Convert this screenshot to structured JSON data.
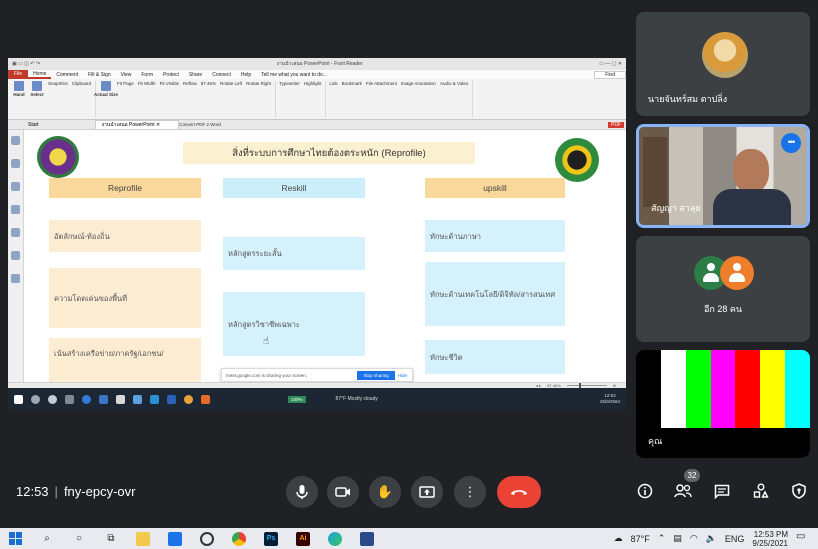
{
  "app": {
    "window_title": "งานนำเสนอ PowerPoint - Foxit Reader",
    "menu_tabs": [
      "File",
      "Home",
      "Comment",
      "Fill & Sign",
      "View",
      "Form",
      "Protect",
      "Share",
      "Connect",
      "Help"
    ],
    "tell_me": "Tell me what you want to do...",
    "find_label": "Find",
    "tools": [
      "SnapShot",
      "Clipboard",
      "Fit Page",
      "Fit Width",
      "Fit Visible",
      "Reflow",
      "97.46%",
      "Rotate Left",
      "Rotate Right",
      "Typewriter",
      "Highlight",
      "Link",
      "Bookmark",
      "File Attachment",
      "Image Annotation",
      "Audio & Video"
    ],
    "tool_big": [
      "Hand",
      "Select",
      "Actual Size"
    ],
    "doc_tabs": [
      "Start",
      "งานนำเสนอ PowerPoint"
    ],
    "convert_label": "Convert PDF 2 Word",
    "zoom_status": "97.46%"
  },
  "slide": {
    "title": "สิ่งที่ระบบการศึกษาไทยต้องตระหนัก (Reprofile)",
    "headers": {
      "reprofile": "Reprofile",
      "reskill": "Reskill",
      "upskill": "upskill"
    },
    "reprofile_items": [
      "อัตลักษณ์-ท้องถิ่น",
      "ความโดดเด่นของพื้นที่",
      "เน้นสร้างเครือข่าย/ภาครัฐ/เอกชน/"
    ],
    "reskill_items": [
      "หลักสูตรระยะสั้น",
      "หลักสูตรวิชาชีพเฉพาะ"
    ],
    "upskill_items": [
      "ทักษะด้านภาษา",
      "ทักษะด้านเทคโนโลยี/ดิจิทัล/สารสนเทศ",
      "ทักษะชีวิต"
    ]
  },
  "share_bar": {
    "message": "meet.google.com is sharing your screen.",
    "stop_label": "Stop sharing",
    "hide_label": "Hide"
  },
  "inner_taskbar": {
    "battery": "100%",
    "weather": "87°F Mostly cloudy",
    "time": "12:53",
    "date": "25/9/2564"
  },
  "participants": [
    {
      "name": "นายจันทร์สม ตาปลิ่ง"
    },
    {
      "name": "สัญญา สาลุย"
    },
    {
      "name": "อีก 28 คน"
    },
    {
      "name": "คุณ"
    }
  ],
  "colors": {
    "meet_bg": "#202124",
    "tile_bg": "#3c4043",
    "active_border": "#8ab4f8",
    "end_call": "#ea4335",
    "reprofile_fill": "#fad79b",
    "reskill_fill": "#cdeefb",
    "title_fill": "#fbf0cf",
    "test_bars": [
      "#000000",
      "#ffffff",
      "#00ff00",
      "#ff00ff",
      "#ff0000",
      "#ffff00",
      "#00ffff"
    ]
  },
  "meeting": {
    "time": "12:53",
    "separator": "|",
    "code": "fny-epcy-ovr",
    "people_count": "32"
  },
  "controls": {
    "mic": "mic-icon",
    "camera": "camera-icon",
    "hand": "raise-hand-icon",
    "present": "present-icon",
    "more": "more-vert-icon",
    "end": "end-call-icon",
    "info": "info-icon",
    "people": "people-icon",
    "chat": "chat-icon",
    "activities": "activities-icon",
    "safety": "safety-icon"
  },
  "taskbar": {
    "temp": "87°F",
    "lang": "ENG",
    "time": "12:53 PM",
    "date": "9/25/2021"
  }
}
